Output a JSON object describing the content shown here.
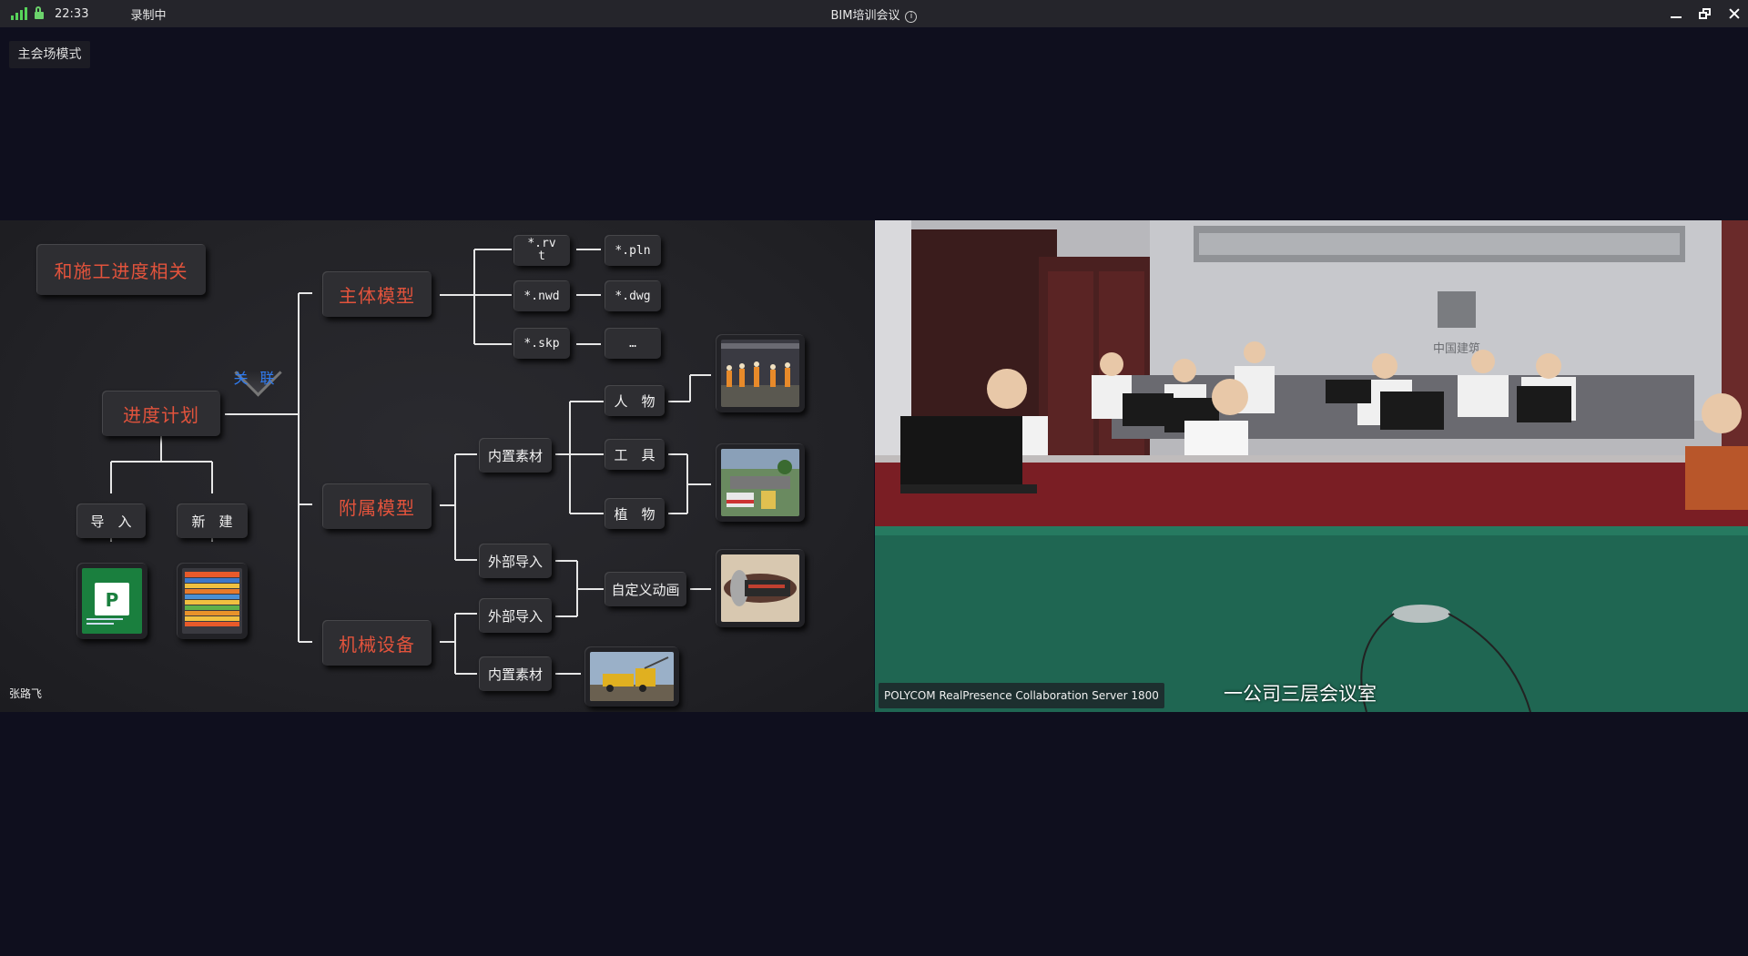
{
  "titlebar": {
    "time": "22:33",
    "recording": "录制中",
    "title": "BIM培训会议",
    "info_glyph": "i",
    "icons": [
      "signal-icon",
      "lock-icon",
      "info-icon",
      "minimize-icon",
      "restore-icon",
      "close-icon"
    ]
  },
  "mode_badge": "主会场模式",
  "slide": {
    "title_box": "和施工进度相关",
    "schedule": "进度计划",
    "relation": "关 联",
    "import": "导　入",
    "new": "新　建",
    "main_model": "主体模型",
    "attached_model": "附属模型",
    "machinery": "机械设备",
    "formats": [
      "*.rv\nt",
      "*.pln",
      "*.nwd",
      "*.dwg",
      "*.skp",
      "…"
    ],
    "builtin_material": "内置素材",
    "external_import": "外部导入",
    "people": "人　物",
    "tools": "工　具",
    "plants": "植　物",
    "custom_animation": "自定义动画",
    "presenter": "张路飞"
  },
  "video": {
    "server": "POLYCOM RealPresence Collaboration Server 1800",
    "room": "一公司三层会议室",
    "wall_logo": "中国建筑"
  },
  "colors": {
    "accent_red": "#e2533c",
    "relation_blue": "#2f7bf0",
    "signal_green": "#57d35a"
  }
}
